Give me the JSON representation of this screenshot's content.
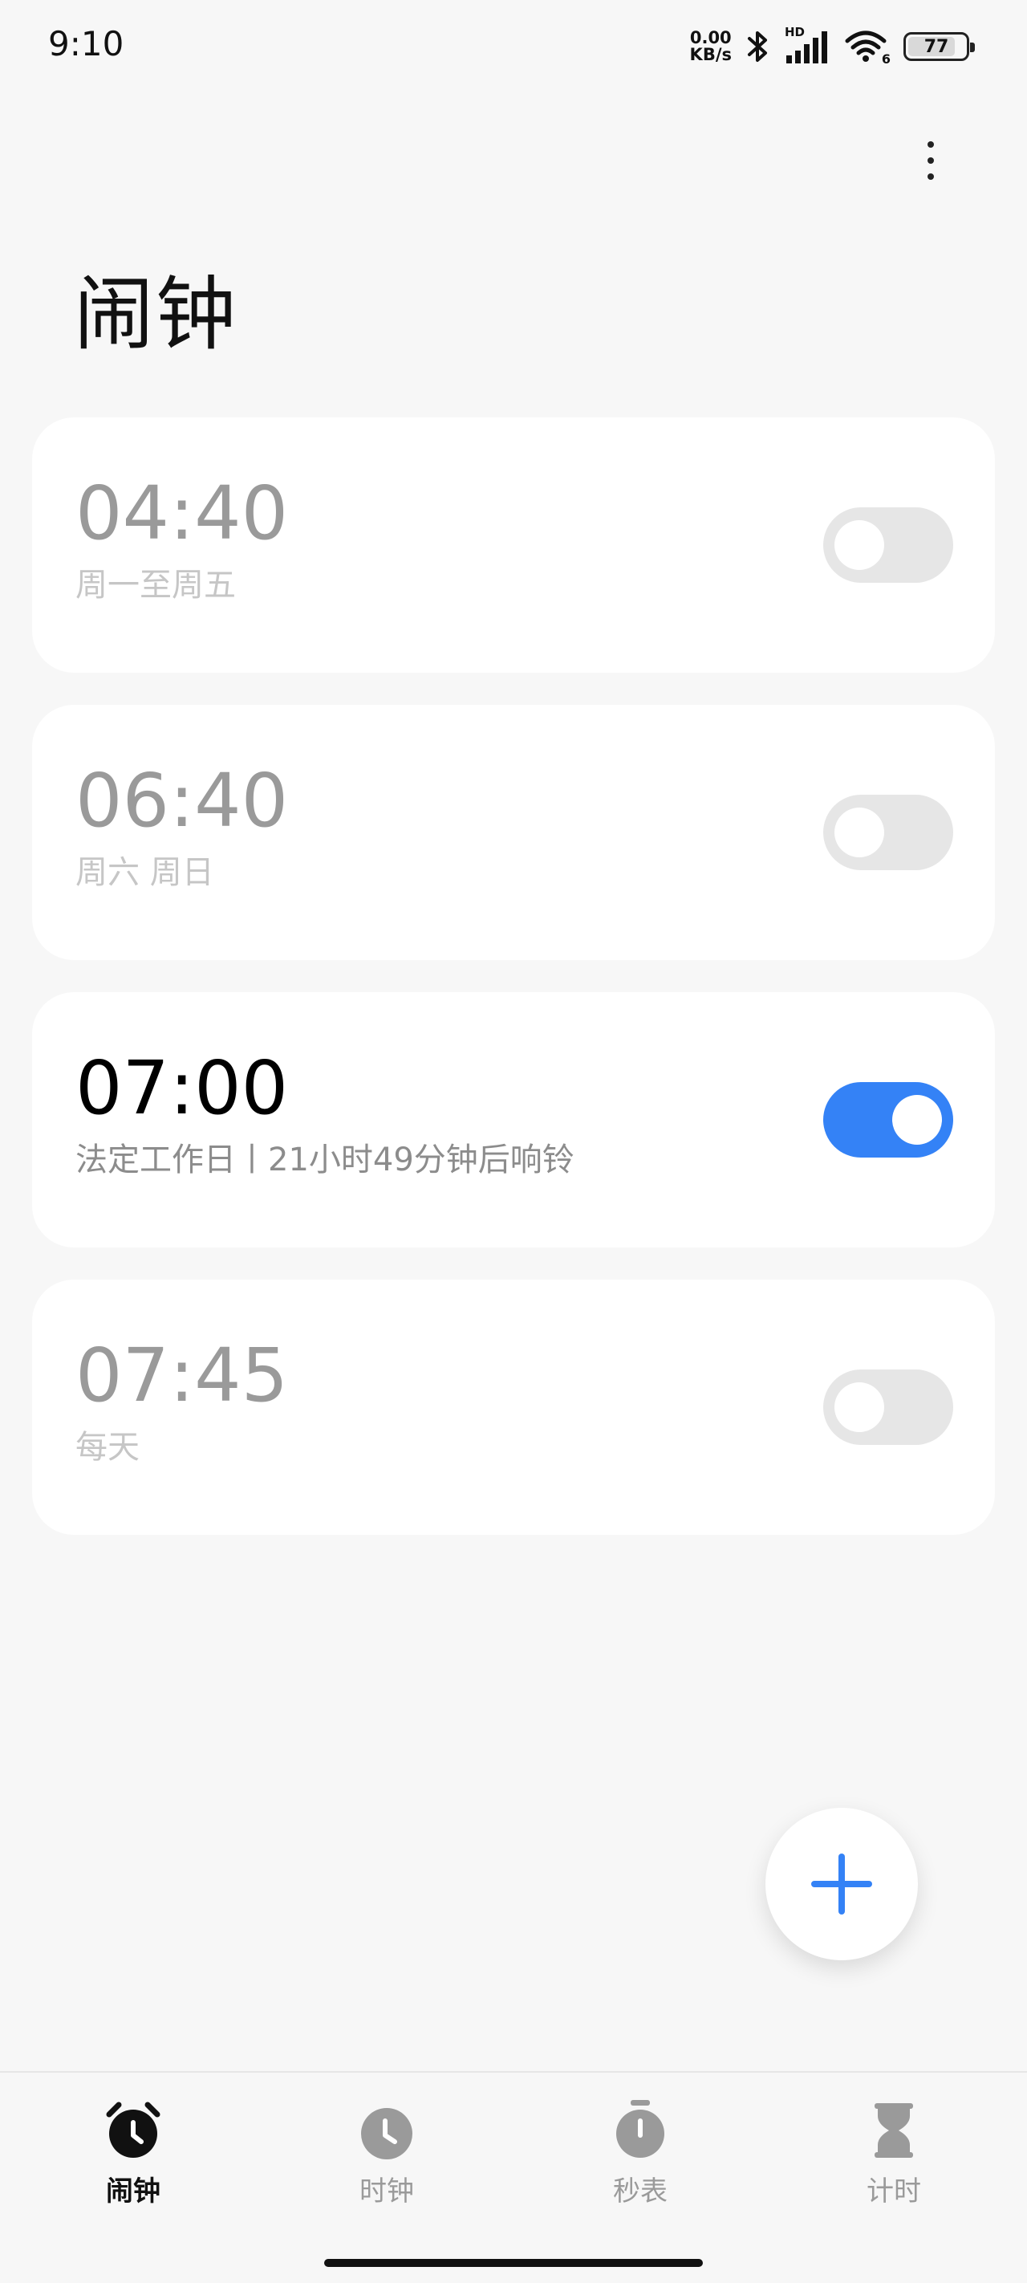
{
  "status_bar": {
    "time": "9:10",
    "net_speed_value": "0.00",
    "net_speed_unit": "KB/s",
    "signal_label": "HD",
    "wifi_label": "6",
    "battery_level": "77"
  },
  "header": {
    "title": "闹钟"
  },
  "alarms": [
    {
      "time": "04:40",
      "subtitle": "周一至周五",
      "enabled": false
    },
    {
      "time": "06:40",
      "subtitle": "周六 周日",
      "enabled": false
    },
    {
      "time": "07:00",
      "subtitle": "法定工作日丨21小时49分钟后响铃",
      "enabled": true
    },
    {
      "time": "07:45",
      "subtitle": "每天",
      "enabled": false
    }
  ],
  "fab": {
    "icon": "plus-icon"
  },
  "bottom_nav": {
    "items": [
      {
        "label": "闹钟",
        "icon": "alarm-clock-icon",
        "active": true
      },
      {
        "label": "时钟",
        "icon": "clock-icon",
        "active": false
      },
      {
        "label": "秒表",
        "icon": "stopwatch-icon",
        "active": false
      },
      {
        "label": "计时",
        "icon": "hourglass-icon",
        "active": false
      }
    ]
  },
  "colors": {
    "accent": "#3482f6",
    "background": "#f7f7f7",
    "card": "#ffffff"
  }
}
